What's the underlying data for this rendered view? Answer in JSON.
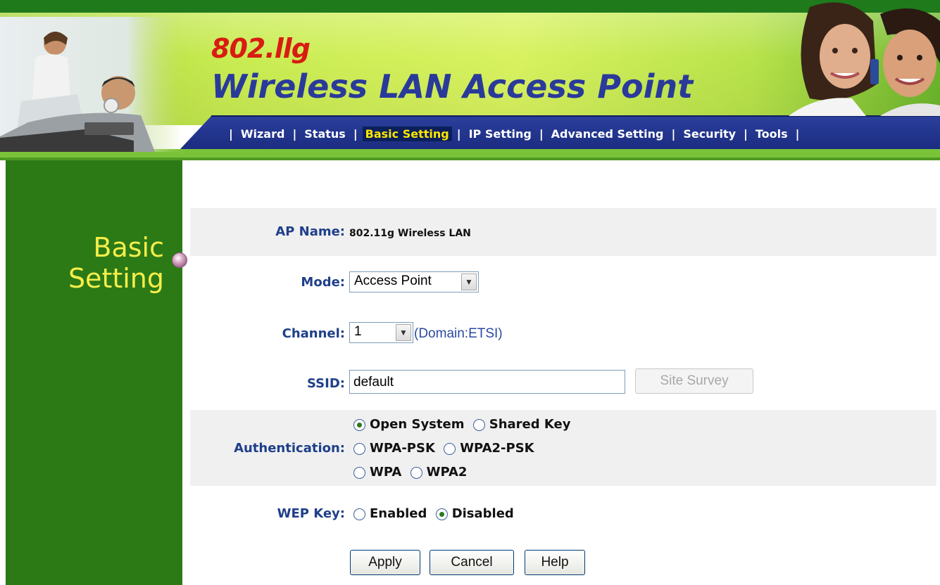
{
  "header": {
    "model": "802.llg",
    "title": "Wireless LAN Access Point",
    "nav": [
      {
        "label": "Wizard",
        "active": false
      },
      {
        "label": "Status",
        "active": false
      },
      {
        "label": "Basic Setting",
        "active": true
      },
      {
        "label": "IP Setting",
        "active": false
      },
      {
        "label": "Advanced Setting",
        "active": false
      },
      {
        "label": "Security",
        "active": false
      },
      {
        "label": "Tools",
        "active": false
      }
    ],
    "separator": "|"
  },
  "sidebar": {
    "title_line1": "Basic",
    "title_line2": "Setting"
  },
  "form": {
    "ap_name": {
      "label": "AP Name:",
      "value": "802.11g Wireless LAN"
    },
    "mode": {
      "label": "Mode:",
      "value": "Access Point"
    },
    "channel": {
      "label": "Channel:",
      "value": "1",
      "domain": "(Domain:ETSI)"
    },
    "ssid": {
      "label": "SSID:",
      "value": "default",
      "site_survey": "Site Survey"
    },
    "authentication": {
      "label": "Authentication:",
      "options": [
        {
          "label": "Open System",
          "checked": true
        },
        {
          "label": "Shared Key",
          "checked": false
        },
        {
          "label": "WPA-PSK",
          "checked": false
        },
        {
          "label": "WPA2-PSK",
          "checked": false
        },
        {
          "label": "WPA",
          "checked": false
        },
        {
          "label": "WPA2",
          "checked": false
        }
      ]
    },
    "wep_key": {
      "label": "WEP Key:",
      "options": [
        {
          "label": "Enabled",
          "checked": false
        },
        {
          "label": "Disabled",
          "checked": true
        }
      ]
    },
    "buttons": {
      "apply": "Apply",
      "cancel": "Cancel",
      "help": "Help"
    }
  },
  "colors": {
    "sidebar_bg": "#2c7a16",
    "sidebar_title": "#f5ee4a",
    "label_blue": "#1f3f8a",
    "nav_active_text": "#ffe600",
    "model_red": "#d81c12",
    "title_blue": "#2a3a9a"
  }
}
